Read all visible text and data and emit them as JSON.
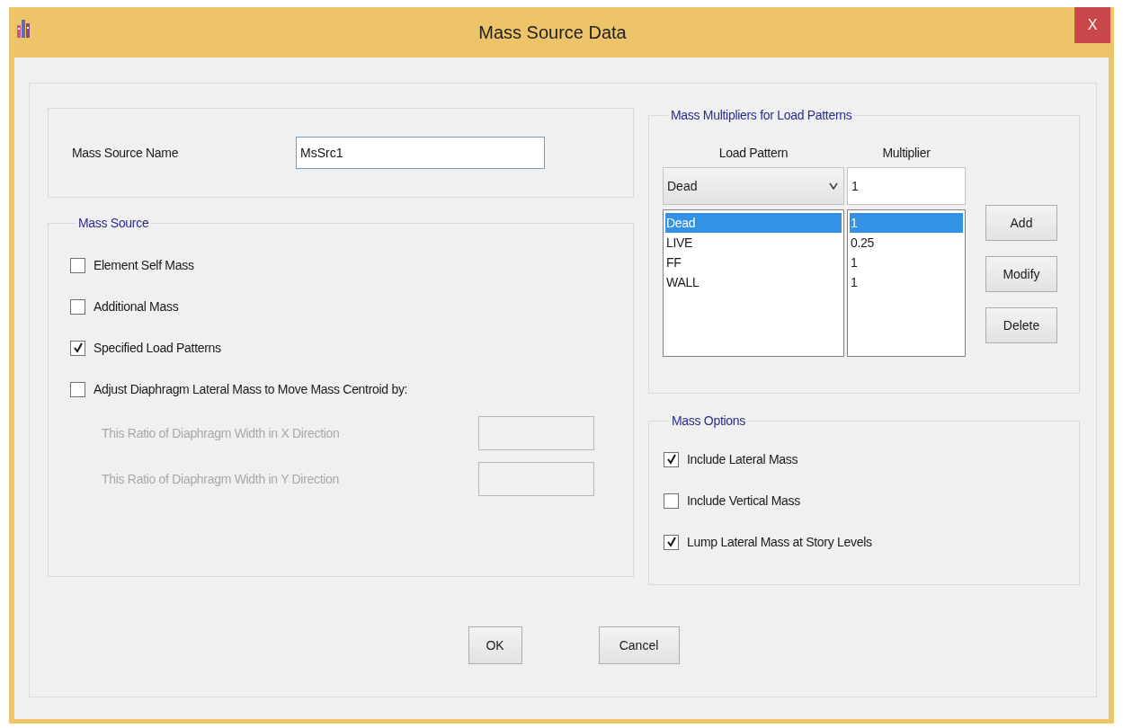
{
  "window": {
    "title": "Mass Source Data",
    "close": "X"
  },
  "mass_source_name": {
    "label": "Mass Source Name",
    "value": "MsSrc1"
  },
  "mass_source": {
    "title": "Mass Source",
    "options": [
      {
        "label": "Element Self Mass",
        "checked": false
      },
      {
        "label": "Additional Mass",
        "checked": false
      },
      {
        "label": "Specified Load Patterns",
        "checked": true
      },
      {
        "label": "Adjust Diaphragm Lateral Mass to Move Mass Centroid by:",
        "checked": false
      }
    ],
    "ratios": [
      {
        "label": "This Ratio of Diaphragm Width in X Direction",
        "disabled": true
      },
      {
        "label": "This Ratio of Diaphragm Width in Y Direction",
        "disabled": true
      }
    ]
  },
  "mass_multipliers": {
    "title": "Mass Multipliers for Load Patterns",
    "columns": [
      "Load Pattern",
      "Multiplier"
    ],
    "load_pattern_select": "Dead",
    "multiplier_value": "1",
    "rows": [
      {
        "load_pattern": "Dead",
        "multiplier": "1",
        "selected": true
      },
      {
        "load_pattern": "LIVE",
        "multiplier": "0.25",
        "selected": false
      },
      {
        "load_pattern": "FF",
        "multiplier": "1",
        "selected": false
      },
      {
        "load_pattern": "WALL",
        "multiplier": "1",
        "selected": false
      }
    ],
    "buttons": [
      "Add",
      "Modify",
      "Delete"
    ]
  },
  "mass_options": {
    "title": "Mass Options",
    "options": [
      {
        "label": "Include Lateral Mass",
        "checked": true
      },
      {
        "label": "Include Vertical Mass",
        "checked": false
      },
      {
        "label": "Lump Lateral Mass at Story Levels",
        "checked": true
      }
    ]
  },
  "buttons": [
    "OK",
    "Cancel"
  ]
}
